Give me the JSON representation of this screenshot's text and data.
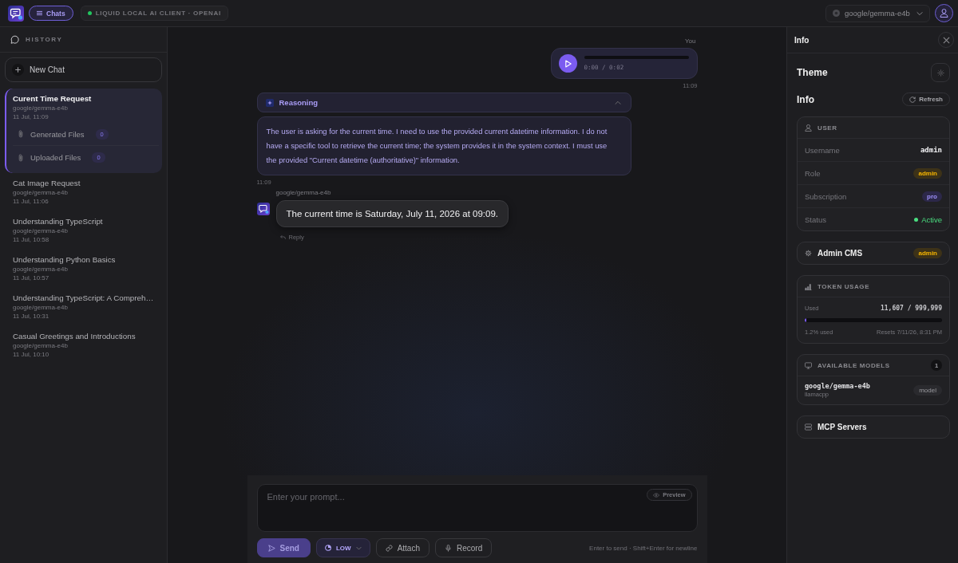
{
  "top_bar": {
    "nav_tab": {
      "label": "Chats",
      "selected": true
    },
    "connection": {
      "label": "LIQUID LOCAL AI CLIENT · OPENAI",
      "connected": true
    },
    "model_selector": {
      "value": "google/gemma-e4b"
    }
  },
  "sidebar": {
    "title": "HISTORY",
    "new_chat": "New Chat",
    "chats": [
      {
        "title": "Curent Time Request",
        "model": "google/gemma-e4b",
        "date": "11 Jul, 11:09",
        "selected": true,
        "files": [
          {
            "label": "Generated Files",
            "count": "0"
          },
          {
            "label": "Uploaded Files",
            "count": "0"
          }
        ]
      },
      {
        "title": "Cat Image Request",
        "model": "google/gemma-e4b",
        "date": "11 Jul, 11:06",
        "selected": false
      },
      {
        "title": "Understanding TypeScript",
        "model": "google/gemma-e4b",
        "date": "11 Jul, 10:58",
        "selected": false
      },
      {
        "title": "Understanding Python Basics",
        "model": "google/gemma-e4b",
        "date": "11 Jul, 10:57",
        "selected": false
      },
      {
        "title": "Understanding TypeScript: A Compreh…",
        "model": "google/gemma-e4b",
        "date": "11 Jul, 10:31",
        "selected": false
      },
      {
        "title": "Casual Greetings and Introductions",
        "model": "google/gemma-e4b",
        "date": "11 Jul, 10:10",
        "selected": false
      }
    ]
  },
  "conversation": {
    "messages": [
      {
        "kind": "audio",
        "sender": "You",
        "elapsed": "0:00 / 0:02",
        "time": "11:09"
      },
      {
        "kind": "reasoning",
        "title": "Reasoning",
        "expanded": true,
        "text": "The user is asking for the current time. I need to use the provided current datetime information. I do not have a specific tool to retrieve the current time; the system provides it in the system context. I must use the provided \"Current datetime (authoritative)\" information.",
        "time": "11:09"
      },
      {
        "kind": "reply",
        "model": "google/gemma-e4b",
        "text": "The current time is Saturday, July 11, 2026 at 09:09.",
        "action": "Reply"
      }
    ]
  },
  "composer": {
    "placeholder": "Enter your prompt...",
    "preview": "Preview",
    "buttons": [
      {
        "kind": "send",
        "label": "Send",
        "disabled": true
      },
      {
        "kind": "effort",
        "label": "LOW"
      },
      {
        "kind": "attach",
        "label": "Attach"
      },
      {
        "kind": "record",
        "label": "Record"
      }
    ],
    "hint": "Enter to send · Shift+Enter for newline"
  },
  "info_panel": {
    "title": "Info",
    "theme_label": "Theme",
    "info_label": "Info",
    "refresh": "Refresh",
    "user": {
      "title": "USER",
      "rows": [
        {
          "label": "Username",
          "value": "admin",
          "kind": "mono"
        },
        {
          "label": "Role",
          "value": "admin",
          "kind": "role"
        },
        {
          "label": "Subscription",
          "value": "pro",
          "kind": "plan"
        },
        {
          "label": "Status",
          "value": "Active",
          "kind": "status"
        }
      ]
    },
    "admin_cms": {
      "label": "Admin CMS",
      "badge": "admin"
    },
    "token_usage": {
      "title": "TOKEN USAGE",
      "used_label": "Used",
      "used": "11,607 / 999,999",
      "level": 0.012,
      "percent": "1.2% used",
      "resets": "Resets 7/11/26, 8:31 PM"
    },
    "models": {
      "title": "AVAILABLE MODELS",
      "count": "1",
      "items": [
        {
          "name": "google/gemma-e4b",
          "provider": "llamacpp",
          "tag": "model"
        }
      ]
    },
    "mcp_servers": {
      "label": "MCP Servers"
    }
  }
}
